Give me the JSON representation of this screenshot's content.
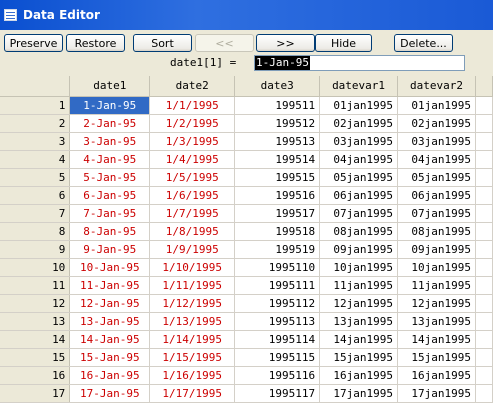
{
  "window": {
    "title": "Data Editor",
    "icon": "table-icon"
  },
  "toolbar": {
    "preserve": "Preserve",
    "restore": "Restore",
    "sort": "Sort",
    "prev": "<<",
    "next": ">>",
    "hide": "Hide",
    "delete": "Delete..."
  },
  "formula": {
    "label": "date1[1] =",
    "value": "1-Jan-95"
  },
  "columns": [
    "date1",
    "date2",
    "date3",
    "datevar1",
    "datevar2"
  ],
  "rows": [
    {
      "n": "1",
      "date1": "1-Jan-95",
      "date2": "1/1/1995",
      "date3": "199511",
      "datevar1": "01jan1995",
      "datevar2": "01jan1995"
    },
    {
      "n": "2",
      "date1": "2-Jan-95",
      "date2": "1/2/1995",
      "date3": "199512",
      "datevar1": "02jan1995",
      "datevar2": "02jan1995"
    },
    {
      "n": "3",
      "date1": "3-Jan-95",
      "date2": "1/3/1995",
      "date3": "199513",
      "datevar1": "03jan1995",
      "datevar2": "03jan1995"
    },
    {
      "n": "4",
      "date1": "4-Jan-95",
      "date2": "1/4/1995",
      "date3": "199514",
      "datevar1": "04jan1995",
      "datevar2": "04jan1995"
    },
    {
      "n": "5",
      "date1": "5-Jan-95",
      "date2": "1/5/1995",
      "date3": "199515",
      "datevar1": "05jan1995",
      "datevar2": "05jan1995"
    },
    {
      "n": "6",
      "date1": "6-Jan-95",
      "date2": "1/6/1995",
      "date3": "199516",
      "datevar1": "06jan1995",
      "datevar2": "06jan1995"
    },
    {
      "n": "7",
      "date1": "7-Jan-95",
      "date2": "1/7/1995",
      "date3": "199517",
      "datevar1": "07jan1995",
      "datevar2": "07jan1995"
    },
    {
      "n": "8",
      "date1": "8-Jan-95",
      "date2": "1/8/1995",
      "date3": "199518",
      "datevar1": "08jan1995",
      "datevar2": "08jan1995"
    },
    {
      "n": "9",
      "date1": "9-Jan-95",
      "date2": "1/9/1995",
      "date3": "199519",
      "datevar1": "09jan1995",
      "datevar2": "09jan1995"
    },
    {
      "n": "10",
      "date1": "10-Jan-95",
      "date2": "1/10/1995",
      "date3": "1995110",
      "datevar1": "10jan1995",
      "datevar2": "10jan1995"
    },
    {
      "n": "11",
      "date1": "11-Jan-95",
      "date2": "1/11/1995",
      "date3": "1995111",
      "datevar1": "11jan1995",
      "datevar2": "11jan1995"
    },
    {
      "n": "12",
      "date1": "12-Jan-95",
      "date2": "1/12/1995",
      "date3": "1995112",
      "datevar1": "12jan1995",
      "datevar2": "12jan1995"
    },
    {
      "n": "13",
      "date1": "13-Jan-95",
      "date2": "1/13/1995",
      "date3": "1995113",
      "datevar1": "13jan1995",
      "datevar2": "13jan1995"
    },
    {
      "n": "14",
      "date1": "14-Jan-95",
      "date2": "1/14/1995",
      "date3": "1995114",
      "datevar1": "14jan1995",
      "datevar2": "14jan1995"
    },
    {
      "n": "15",
      "date1": "15-Jan-95",
      "date2": "1/15/1995",
      "date3": "1995115",
      "datevar1": "15jan1995",
      "datevar2": "15jan1995"
    },
    {
      "n": "16",
      "date1": "16-Jan-95",
      "date2": "1/16/1995",
      "date3": "1995116",
      "datevar1": "16jan1995",
      "datevar2": "16jan1995"
    },
    {
      "n": "17",
      "date1": "17-Jan-95",
      "date2": "1/17/1995",
      "date3": "1995117",
      "datevar1": "17jan1995",
      "datevar2": "17jan1995"
    }
  ],
  "colors": {
    "string_text": "#cc0000",
    "selection": "#316ac5",
    "title_bar": "#1a5ad6"
  }
}
